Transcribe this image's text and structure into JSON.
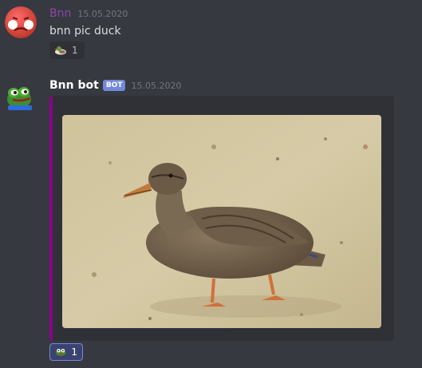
{
  "messages": [
    {
      "username": "Bnn",
      "timestamp": "15.05.2020",
      "content": "bnn pic duck",
      "reaction": {
        "emoji": "duck-emoji",
        "count": "1"
      },
      "avatar": "red-sad-face-emoji"
    },
    {
      "username": "Bnn bot",
      "badge": "BOT",
      "timestamp": "15.05.2020",
      "avatar": "pepe-frog",
      "embed": {
        "accent_color": "#8b008b",
        "image": "photo of a mallard duck walking on sand"
      },
      "reaction": {
        "emoji": "frog-emoji",
        "count": "1"
      }
    }
  ],
  "colors": {
    "background": "#36393f",
    "embed_background": "#2f3136",
    "bot_badge": "#7289da",
    "username_bnn": "#8e44ad"
  }
}
